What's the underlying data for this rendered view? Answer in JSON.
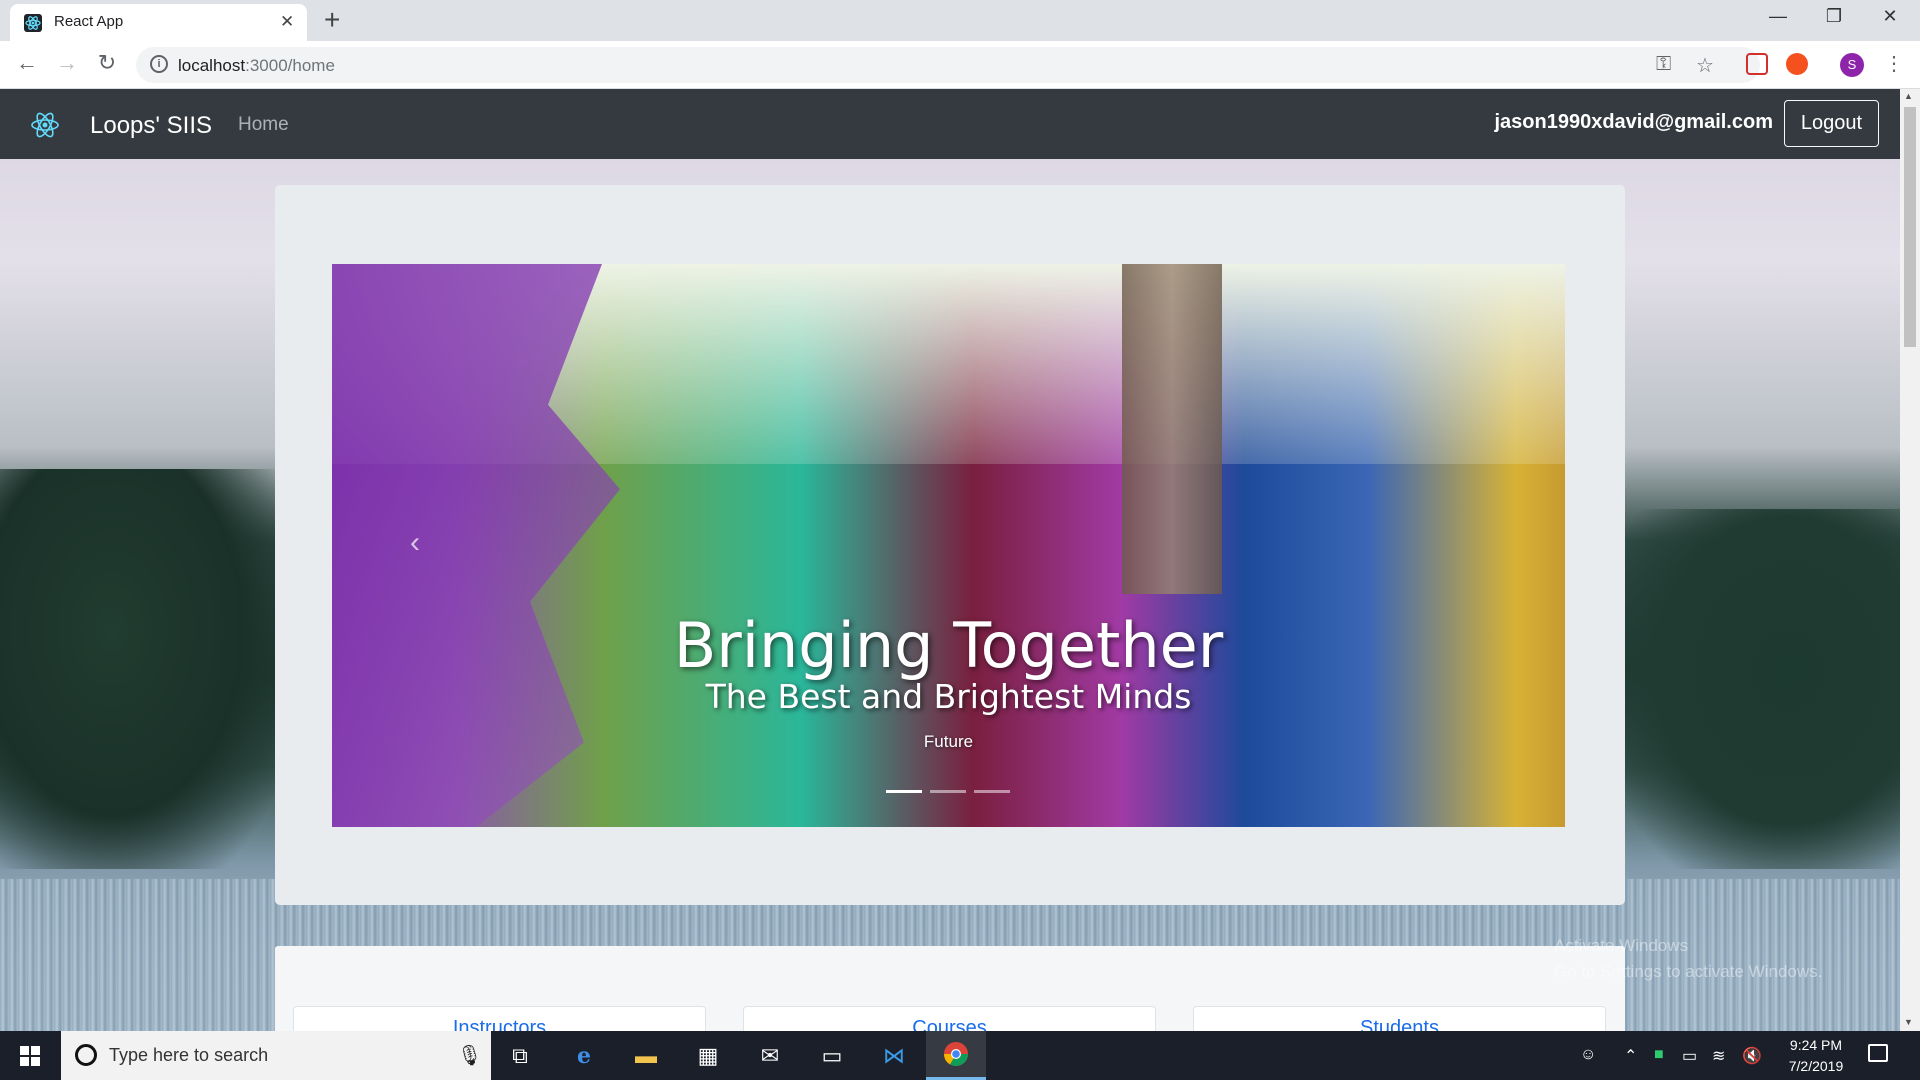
{
  "browser": {
    "tab_title": "React App",
    "url_host": "localhost",
    "url_path": ":3000/home",
    "new_tab_symbol": "+",
    "profile_initial": "S",
    "icons": [
      "back-icon",
      "forward-icon",
      "reload-icon",
      "info-icon",
      "key-icon",
      "star-icon",
      "pocket-icon",
      "extension-icon",
      "menu-icon"
    ]
  },
  "navbar": {
    "brand": "Loops' SIIS",
    "home_link": "Home",
    "user_email": "jason1990xdavid@gmail.com",
    "logout_label": "Logout",
    "bg_color": "#343a40"
  },
  "carousel": {
    "caption_title": "Bringing Together",
    "caption_subtitle": "The Best and Brightest Minds",
    "caption_small": "Future",
    "slide_count": 3,
    "active_slide": 1
  },
  "cards": [
    {
      "title": "Instructors"
    },
    {
      "title": "Courses"
    },
    {
      "title": "Students"
    }
  ],
  "watermark": {
    "line1": "Activate Windows",
    "line2": "Go to Settings to activate Windows."
  },
  "taskbar": {
    "search_placeholder": "Type here to search",
    "time": "9:24 PM",
    "date": "7/2/2019"
  }
}
